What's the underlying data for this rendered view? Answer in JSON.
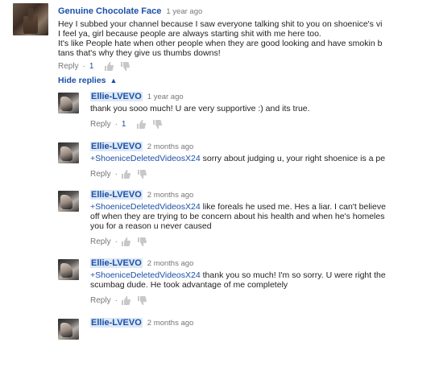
{
  "main_comment": {
    "author": "Genuine Chocolate Face",
    "time": "1 year ago",
    "lines": [
      "Hey I subbed your channel because I saw everyone talking shit to you on shoenice's vi",
      "I feel ya, girl because people are always starting shit with me here too.",
      "It's like People hate when other people when they are good looking and have smokin b",
      "tans that's why they give us thumbs downs!"
    ],
    "reply_label": "Reply",
    "likes": "1"
  },
  "hide_replies_label": "Hide replies",
  "replies": [
    {
      "author": "Ellie-LVEVO",
      "time": "1 year ago",
      "lines": [
        {
          "mention": "",
          "text": "thank you sooo much! U are very supportive :) and its true."
        }
      ],
      "reply_label": "Reply",
      "likes": "1"
    },
    {
      "author": "Ellie-LVEVO",
      "time": "2 months ago",
      "lines": [
        {
          "mention": "+ShoeniceDeletedVideosX24",
          "text": " sorry about judging u, your right shoenice is a pe"
        }
      ],
      "reply_label": "Reply",
      "likes": ""
    },
    {
      "author": "Ellie-LVEVO",
      "time": "2 months ago",
      "lines": [
        {
          "mention": "+ShoeniceDeletedVideosX24",
          "text": " like foreals he used me. Hes a liar. I can't believe"
        },
        {
          "mention": "",
          "text": "off when they are trying to be concern about his health and when he's homeles"
        },
        {
          "mention": "",
          "text": "you for a reason u never caused"
        }
      ],
      "reply_label": "Reply",
      "likes": ""
    },
    {
      "author": "Ellie-LVEVO",
      "time": "2 months ago",
      "lines": [
        {
          "mention": "+ShoeniceDeletedVideosX24",
          "text": " thank you so much! I'm so sorry. U were right the"
        },
        {
          "mention": "",
          "text": "scumbag dude. He took advantage of me completely"
        }
      ],
      "reply_label": "Reply",
      "likes": ""
    },
    {
      "author": "Ellie-LVEVO",
      "time": "2 months ago",
      "lines": [],
      "reply_label": "",
      "likes": ""
    }
  ],
  "icons": {
    "like": "thumbs-up-icon",
    "dislike": "thumbs-down-icon",
    "chevron": "chevron-up-icon"
  },
  "colors": {
    "link": "#1a4fa8",
    "muted": "#777777",
    "author_highlight": "#dde8f6"
  }
}
